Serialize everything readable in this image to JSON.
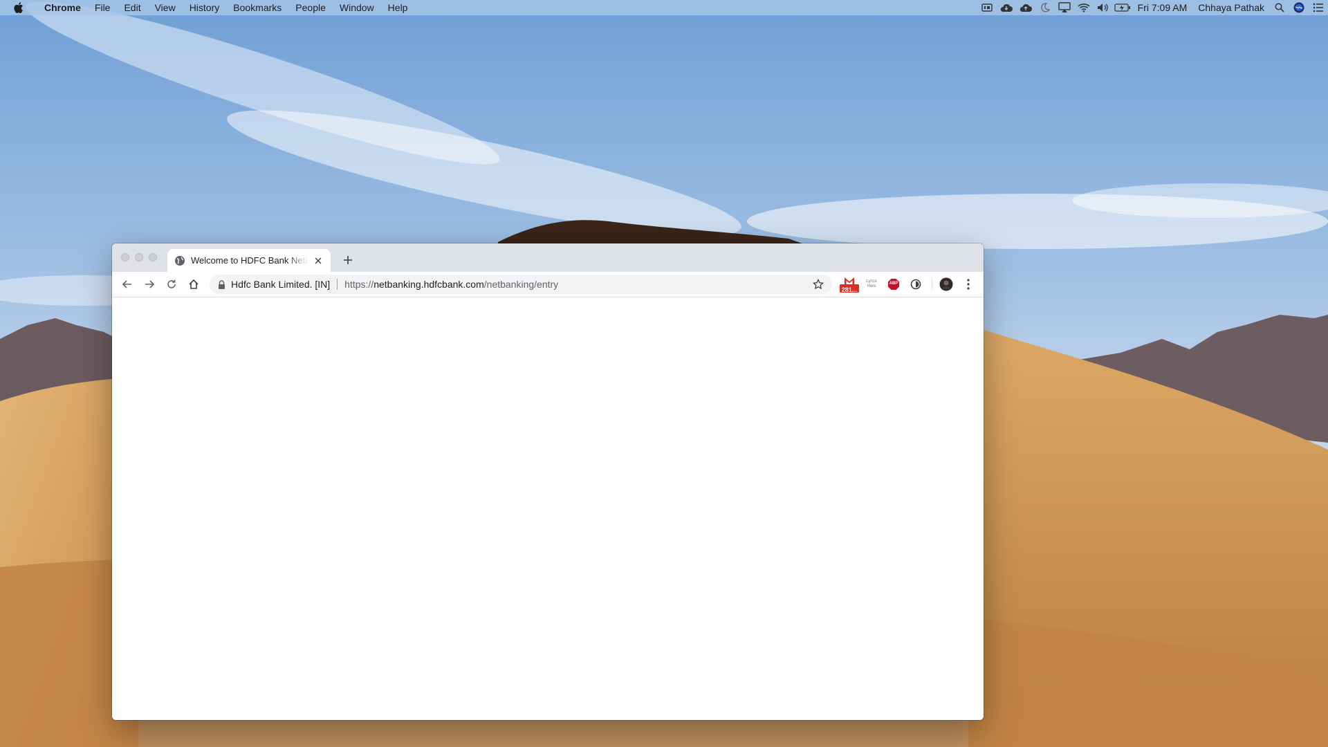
{
  "menubar": {
    "app_name": "Chrome",
    "menus": [
      "File",
      "Edit",
      "View",
      "History",
      "Bookmarks",
      "People",
      "Window",
      "Help"
    ],
    "clock": "Fri 7:09 AM",
    "user_name": "Chhaya Pathak",
    "status_icons": [
      "media-icon",
      "cloud-icon",
      "cloud-upload-icon",
      "moon-icon",
      "airplay-icon",
      "wifi-icon",
      "volume-icon",
      "battery-icon"
    ]
  },
  "window": {
    "tab": {
      "title": "Welcome to HDFC Bank NetBanking",
      "favicon": "globe-icon"
    },
    "address_bar": {
      "site_name": "Hdfc Bank Limited. [IN]",
      "url_scheme": "https://",
      "url_host": "netbanking.hdfcbank.com",
      "url_path": "/netbanking/entry"
    },
    "extensions": {
      "gmail_badge": "281...",
      "lyrics_label_1": "Lyrics",
      "lyrics_label_2": "Here",
      "abp_label": "ABP"
    }
  },
  "colors": {
    "menubar_bg": "#a8c6e6",
    "tabstrip_bg": "#dee1e6",
    "omnibox_bg": "#f1f3f4",
    "gmail_red": "#d93025",
    "abp_red": "#c70d2c"
  }
}
